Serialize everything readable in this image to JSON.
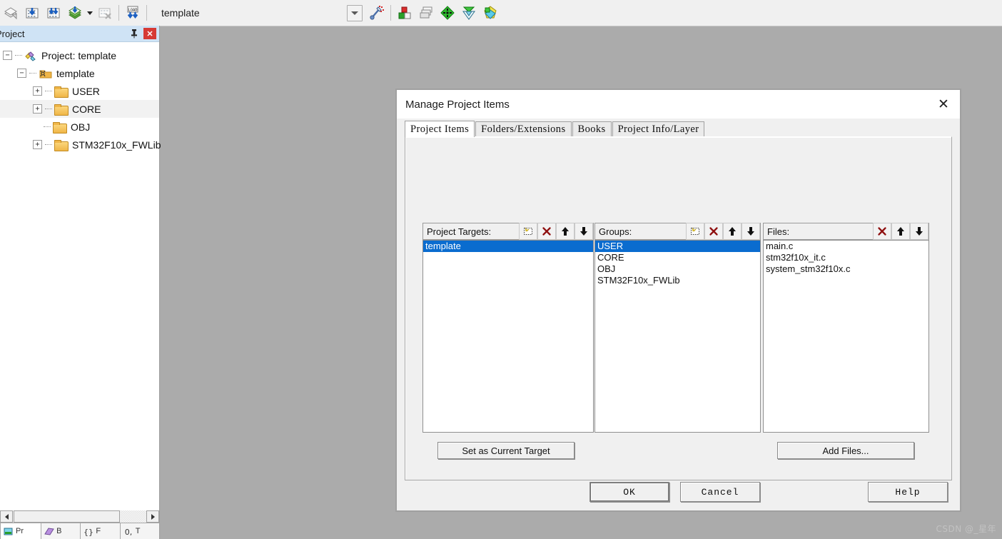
{
  "toolbar": {
    "buttons": [
      {
        "name": "translate-button",
        "title": "Translate"
      },
      {
        "name": "build-button",
        "title": "Build"
      },
      {
        "name": "rebuild-button",
        "title": "Rebuild"
      },
      {
        "name": "batch-build-button",
        "title": "Batch Build"
      },
      {
        "name": "stop-build-button",
        "title": "Stop Build"
      },
      {
        "name": "download-button",
        "title": "Download"
      },
      {
        "name": "target-options-button",
        "title": "Options for Target"
      },
      {
        "name": "manage-components-button",
        "title": "Manage Project Items"
      },
      {
        "name": "manage-run-time-button",
        "title": "Manage Run-Time Environment"
      },
      {
        "name": "select-software-packs-button",
        "title": "Select Software Packs"
      },
      {
        "name": "pack-installer-button",
        "title": "Pack Installer"
      }
    ],
    "target_combo_value": "template",
    "wizard_icon": "configuration-wizard-icon"
  },
  "project_pane": {
    "title": "Project",
    "pin_icon": "pin-icon",
    "close_icon": "close-icon",
    "tree": [
      {
        "label": "Project: template",
        "indent": 0,
        "expander": "minus",
        "icon": "project-icon"
      },
      {
        "label": "template",
        "indent": 1,
        "expander": "minus",
        "icon": "target-folder-icon"
      },
      {
        "label": "USER",
        "indent": 2,
        "expander": "plus",
        "icon": "folder-icon"
      },
      {
        "label": "CORE",
        "indent": 2,
        "expander": "plus",
        "icon": "folder-icon",
        "highlight": true
      },
      {
        "label": "OBJ",
        "indent": 2,
        "expander": "none",
        "icon": "folder-icon"
      },
      {
        "label": "STM32F10x_FWLib",
        "indent": 2,
        "expander": "plus",
        "icon": "folder-icon"
      }
    ],
    "bottom_tabs": [
      {
        "label": "Pr",
        "icon": "project-tab-icon",
        "selected": true
      },
      {
        "label": "B",
        "icon": "books-tab-icon",
        "selected": false
      },
      {
        "label": "F",
        "icon": "functions-tab-icon",
        "selected": false
      },
      {
        "label": "T",
        "icon": "templates-tab-icon",
        "selected": false
      }
    ]
  },
  "dialog": {
    "title": "Manage Project Items",
    "close_icon": "close-icon",
    "tabs": [
      {
        "label": "Project Items",
        "active": true
      },
      {
        "label": "Folders/Extensions",
        "active": false
      },
      {
        "label": "Books",
        "active": false
      },
      {
        "label": "Project Info/Layer",
        "active": false
      }
    ],
    "targets": {
      "label": "Project Targets:",
      "tools": [
        "new-item-icon",
        "delete-icon",
        "move-up-icon",
        "move-down-icon"
      ],
      "items": [
        {
          "label": "template",
          "selected": true
        }
      ],
      "action_label": "Set as Current Target"
    },
    "groups": {
      "label": "Groups:",
      "tools": [
        "new-item-icon",
        "delete-icon",
        "move-up-icon",
        "move-down-icon"
      ],
      "items": [
        {
          "label": "USER",
          "selected": true
        },
        {
          "label": "CORE",
          "selected": false
        },
        {
          "label": "OBJ",
          "selected": false
        },
        {
          "label": "STM32F10x_FWLib",
          "selected": false
        }
      ]
    },
    "files": {
      "label": "Files:",
      "tools": [
        "delete-icon",
        "move-up-icon",
        "move-down-icon"
      ],
      "items": [
        {
          "label": "main.c",
          "selected": false
        },
        {
          "label": "stm32f10x_it.c",
          "selected": false
        },
        {
          "label": "system_stm32f10x.c",
          "selected": false
        }
      ],
      "action_label": "Add Files..."
    },
    "footer": {
      "ok_label": "OK",
      "cancel_label": "Cancel",
      "help_label": "Help"
    }
  },
  "watermark": "CSDN @_星年",
  "colors": {
    "selection_blue": "#0a6ccf",
    "pane_header_blue": "#cfe3f5",
    "close_red": "#d63a35",
    "mdi_background": "#ababab",
    "delete_x": "#8f1010"
  }
}
